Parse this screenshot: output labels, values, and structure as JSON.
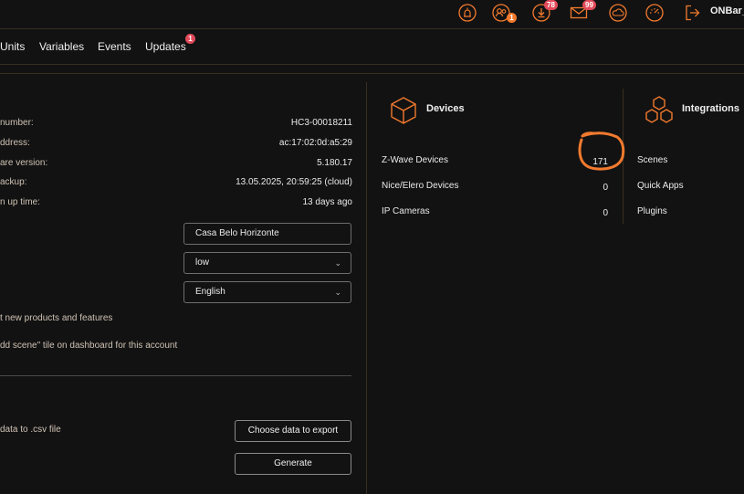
{
  "header": {
    "user_name": "ONBar_e",
    "badges": {
      "users": "1",
      "notifications": "78",
      "messages": "99"
    },
    "icons": [
      "alarm-icon",
      "users-icon",
      "notification-icon",
      "mail-icon",
      "weather-icon",
      "gauge-icon",
      "logout-icon"
    ]
  },
  "nav": {
    "items": [
      "Units",
      "Variables",
      "Events",
      "Updates"
    ],
    "updates_badge": "1"
  },
  "info": {
    "rows": [
      {
        "label": "number:",
        "value": "HC3-00018211"
      },
      {
        "label": "ddress:",
        "value": "ac:17:02:0d:a5:29"
      },
      {
        "label": "are version:",
        "value": "5.180.17"
      },
      {
        "label": "ackup:",
        "value": "13.05.2025, 20:59:25 (cloud)"
      },
      {
        "label": "n up time:",
        "value": "13 days ago"
      }
    ],
    "location_name": "Casa Belo Horizonte",
    "level_select": "low",
    "language_select": "English",
    "newsletter_text": "t new products and features",
    "add_scene_text": "dd scene\" tile on dashboard for this account"
  },
  "export": {
    "description": "data to .csv file",
    "choose_label": "Choose data to export",
    "generate_label": "Generate"
  },
  "devices": {
    "title": "Devices",
    "rows": [
      {
        "label": "Z-Wave Devices",
        "value": "171"
      },
      {
        "label": "Nice/Elero Devices",
        "value": "0"
      },
      {
        "label": "IP Cameras",
        "value": "0"
      }
    ]
  },
  "integrations": {
    "title": "Integrations",
    "rows": [
      "Scenes",
      "Quick Apps",
      "Plugins"
    ]
  },
  "colors": {
    "accent": "#f27a2e",
    "badge": "#e24a5a",
    "background": "#121212"
  }
}
